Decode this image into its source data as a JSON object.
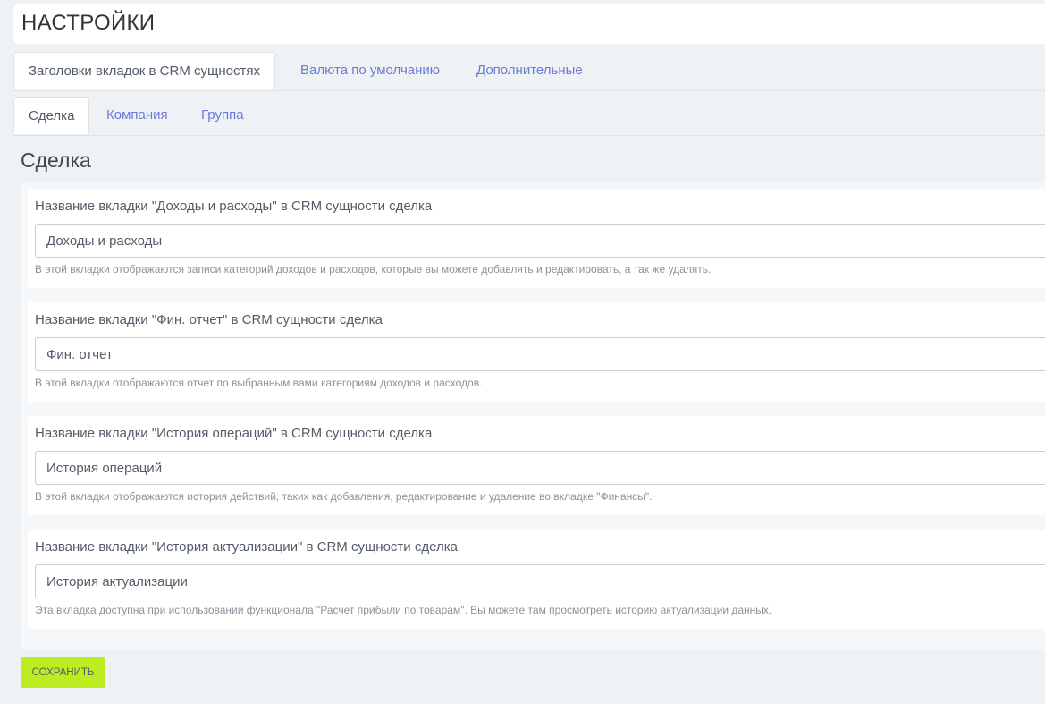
{
  "header": {
    "title": "НАСТРОЙКИ"
  },
  "tabs_top": [
    {
      "label": "Заголовки вкладок в CRM сущностях",
      "active": true
    },
    {
      "label": "Валюта по умолчанию",
      "active": false
    },
    {
      "label": "Дополнительные",
      "active": false
    }
  ],
  "tabs_sub": [
    {
      "label": "Сделка",
      "active": true
    },
    {
      "label": "Компания",
      "active": false
    },
    {
      "label": "Группа",
      "active": false
    }
  ],
  "section": {
    "title": "Сделка"
  },
  "fields": [
    {
      "label": "Название вкладки \"Доходы и расходы\" в CRM сущности сделка",
      "value": "Доходы и расходы",
      "hint": "В этой вкладки отображаются записи категорий доходов и расходов, которые вы можете добавлять и редактировать, а так же удалять."
    },
    {
      "label": "Название вкладки \"Фин. отчет\" в CRM сущности сделка",
      "value": "Фин. отчет",
      "hint": "В этой вкладки отображаются отчет по выбранным вами категориям доходов и расходов."
    },
    {
      "label": "Название вкладки \"История операций\" в CRM сущности сделка",
      "value": "История операций",
      "hint": "В этой вкладки отображаются история действий, таких как добавления, редактирование и удаление во вкладке \"Финансы\"."
    },
    {
      "label": "Название вкладки \"История актуализации\" в CRM сущности сделка",
      "value": "История актуализации",
      "hint": "Эта вкладка доступна при использовании функционала \"Расчет прибыли по товарам\". Вы можете там просмотреть историю актуализации данных."
    }
  ],
  "actions": {
    "save_label": "СОХРАНИТЬ"
  },
  "colors": {
    "accent_button": "#bbed21",
    "link": "#6a7bd6",
    "background": "#eef2f4"
  }
}
